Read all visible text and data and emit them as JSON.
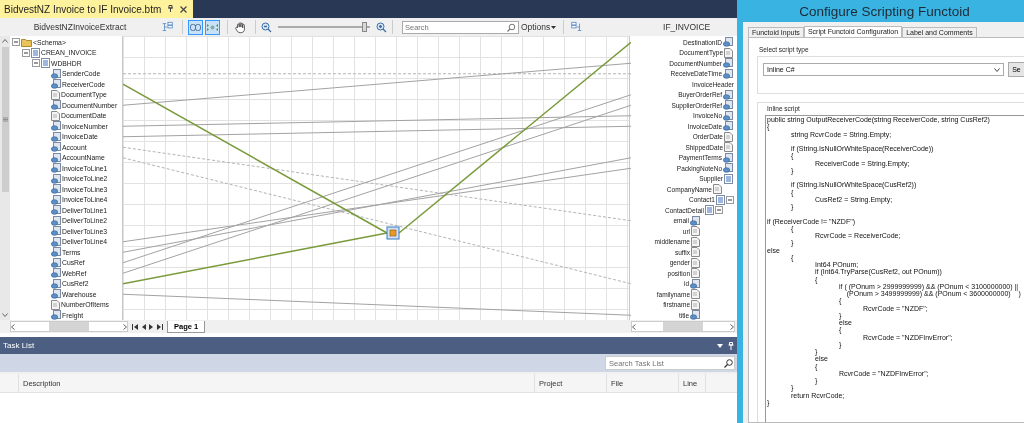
{
  "editor_tab": {
    "title": "BidvestNZ Invoice to IF Invoice.btm",
    "selected": true
  },
  "toolbar": {
    "toggles": [
      {
        "selected": true
      },
      {
        "selected": true
      }
    ],
    "zoom": {
      "level": 0.97
    },
    "search": {
      "placeholder": "Search"
    },
    "options": "Options"
  },
  "source_schema": {
    "title": "BidvestNZInvoiceExtract",
    "tree": [
      {
        "label": "<Schema>",
        "kind": "folder",
        "expanded": true,
        "children": [
          {
            "label": "CREAN_INVOICE",
            "kind": "record",
            "expanded": true,
            "children": [
              {
                "label": "WDBHDR",
                "kind": "record",
                "expanded": true,
                "children": [
                  {
                    "label": "SenderCode",
                    "kind": "field"
                  },
                  {
                    "label": "ReceiverCode",
                    "kind": "field"
                  },
                  {
                    "label": "DocumentType",
                    "kind": "attribute"
                  },
                  {
                    "label": "DocumentNumber",
                    "kind": "field"
                  },
                  {
                    "label": "DocumentDate",
                    "kind": "attribute"
                  },
                  {
                    "label": "InvoiceNumber",
                    "kind": "field"
                  },
                  {
                    "label": "InvoiceDate",
                    "kind": "field"
                  },
                  {
                    "label": "Account",
                    "kind": "field"
                  },
                  {
                    "label": "AccountName",
                    "kind": "field"
                  },
                  {
                    "label": "InvoiceToLine1",
                    "kind": "field"
                  },
                  {
                    "label": "InvoiceToLine2",
                    "kind": "field"
                  },
                  {
                    "label": "InvoiceToLine3",
                    "kind": "field"
                  },
                  {
                    "label": "InvoiceToLine4",
                    "kind": "field"
                  },
                  {
                    "label": "DeliverToLine1",
                    "kind": "field"
                  },
                  {
                    "label": "DeliverToLine2",
                    "kind": "field"
                  },
                  {
                    "label": "DeliverToLine3",
                    "kind": "field"
                  },
                  {
                    "label": "DeliverToLine4",
                    "kind": "field"
                  },
                  {
                    "label": "Terms",
                    "kind": "field"
                  },
                  {
                    "label": "CusRef",
                    "kind": "field"
                  },
                  {
                    "label": "WebRef",
                    "kind": "field"
                  },
                  {
                    "label": "CusRef2",
                    "kind": "field"
                  },
                  {
                    "label": "Warehouse",
                    "kind": "field"
                  },
                  {
                    "label": "NumberOfItems",
                    "kind": "attribute"
                  },
                  {
                    "label": "Freight",
                    "kind": "field"
                  }
                ]
              }
            ]
          }
        ]
      }
    ]
  },
  "destination_schema": {
    "title": "IF_INVOICE",
    "tree": [
      {
        "label": "DestinationID",
        "kind": "field"
      },
      {
        "label": "DocumentType",
        "kind": "attribute"
      },
      {
        "label": "DocumentNumber",
        "kind": "field"
      },
      {
        "label": "ReceiveDateTime",
        "kind": "field"
      },
      {
        "label": "InvoiceHeader",
        "kind": "group"
      },
      {
        "label": "BuyerOrderRef",
        "kind": "field"
      },
      {
        "label": "SupplierOrderRef",
        "kind": "field"
      },
      {
        "label": "InvoiceNo",
        "kind": "field"
      },
      {
        "label": "InvoiceDate",
        "kind": "field"
      },
      {
        "label": "OrderDate",
        "kind": "attribute"
      },
      {
        "label": "ShippedDate",
        "kind": "attribute"
      },
      {
        "label": "PaymentTerms",
        "kind": "field"
      },
      {
        "label": "PackingNoteNo",
        "kind": "field"
      },
      {
        "label": "Supplier",
        "kind": "record",
        "children": [
          {
            "label": "CompanyName",
            "kind": "attribute"
          },
          {
            "label": "Contact1",
            "kind": "record",
            "expanded": true,
            "children": [
              {
                "label": "ContactDetail",
                "kind": "record",
                "expanded": true,
                "children": [
                  {
                    "label": "email",
                    "kind": "field"
                  },
                  {
                    "label": "url",
                    "kind": "attribute"
                  },
                  {
                    "label": "middlename",
                    "kind": "attribute"
                  },
                  {
                    "label": "suffix",
                    "kind": "attribute"
                  },
                  {
                    "label": "gender",
                    "kind": "attribute"
                  },
                  {
                    "label": "position",
                    "kind": "attribute"
                  },
                  {
                    "label": "id",
                    "kind": "field"
                  },
                  {
                    "label": "familyname",
                    "kind": "attribute"
                  },
                  {
                    "label": "firstname",
                    "kind": "attribute"
                  },
                  {
                    "label": "title",
                    "kind": "field"
                  }
                ]
              }
            ]
          }
        ]
      }
    ]
  },
  "page_tabs": [
    {
      "label": "Page 1",
      "selected": true
    }
  ],
  "task_list": {
    "title": "Task List",
    "search": {
      "placeholder": "Search Task List"
    },
    "columns": [
      "Description",
      "Project",
      "File",
      "Line"
    ]
  },
  "dialog": {
    "title": "Configure Scripting Functoid",
    "tabs": [
      {
        "label": "Functoid Inputs",
        "selected": false
      },
      {
        "label": "Script Functoid Configuration",
        "selected": true
      },
      {
        "label": "Label and Comments",
        "selected": false
      }
    ],
    "script_type": {
      "label": "Select script type",
      "value": "Inline C#",
      "button": "Se"
    },
    "inline_script": {
      "label": "Inline script",
      "code": "public string OutputReceiverCode(string ReceiverCode, string CusRef2)\n{\n\tstring RcvrCode = String.Empty;\n\n\tif (String.IsNullOrWhiteSpace(ReceiverCode))\n\t{\n\t\tReceiverCode = String.Empty;\n\t}\n\n\tif (String.IsNullOrWhiteSpace(CusRef2))\n\t{\n\t\tCusRef2 = String.Empty;\n\t}\n\nif (ReceiverCode != \"NZDF\")\n\t{\n\t\tRcvrCode = ReceiverCode;\n\t}\nelse\n\t{\n\t\tInt64 POnum;\n\t\tif (Int64.TryParse(CusRef2, out POnum))\n\t\t{\n\t\t\tif ( (POnum > 2999999999) && (POnum < 3100000000) ||\n\t\t\t    (POnum > 3499999999) && (POnum < 3600000000)    )\n\t\t\t{\n\t\t\t\tRcvrCode = \"NZDF\";\n\t\t\t}\n\t\t\telse\n\t\t\t{\n\t\t\t\tRcvrCode = \"NZDFInvError\";\n\t\t\t}\n\t\t}\n\t\telse\n\t\t{\n\t\t\tRcvrCode = \"NZDFInvError\";\n\t\t}\n\t}\n\treturn RcvrCode;\n}"
    }
  }
}
